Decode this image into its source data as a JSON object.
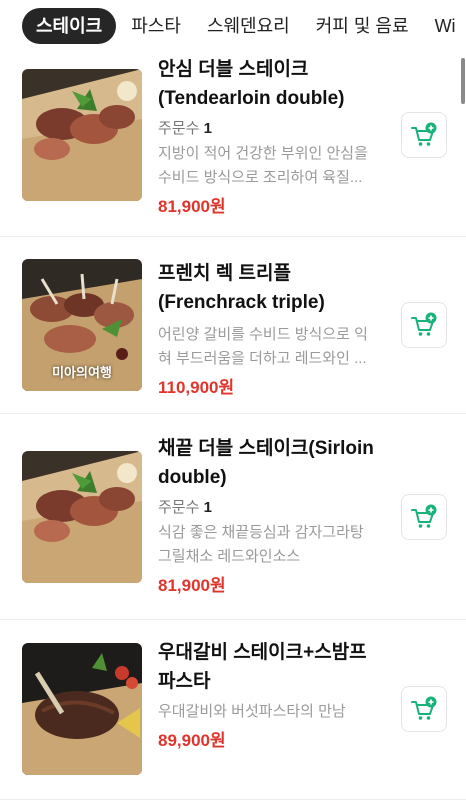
{
  "tabs": [
    "스테이크",
    "파스타",
    "스웨덴요리",
    "커피 및 음료",
    "Wi"
  ],
  "accent_color": "#e0352c",
  "cart_icon_color": "#19b37a",
  "qty_label": "주문수",
  "items": [
    {
      "name": "안심 더블 스테이크 (Tendearloin double)",
      "qty": "1",
      "desc": "지방이 적어 건강한 부위인 안심을 수비드 방식으로 조리하여 육질...",
      "price": "81,900원",
      "image_icon": "steak-photo"
    },
    {
      "name": "프렌치 렉 트리플 (Frenchrack triple)",
      "qty": "",
      "desc": "어린양 갈비를 수비드 방식으로 익혀 부드러움을 더하고 레드와인 ...",
      "price": "110,900원",
      "image_icon": "lamb-rack-photo",
      "watermark": "미아의여행"
    },
    {
      "name": "채끝 더블 스테이크(Sirloin double)",
      "qty": "1",
      "desc": "식감 좋은 채끝등심과 감자그라탕 그릴채소 레드와인소스",
      "price": "81,900원",
      "image_icon": "steak-photo"
    },
    {
      "name": "우대갈비 스테이크+스밤프 파스타",
      "qty": "",
      "desc": "우대갈비와 버섯파스타의 만남",
      "price": "89,900원",
      "image_icon": "rib-steak-photo"
    }
  ]
}
